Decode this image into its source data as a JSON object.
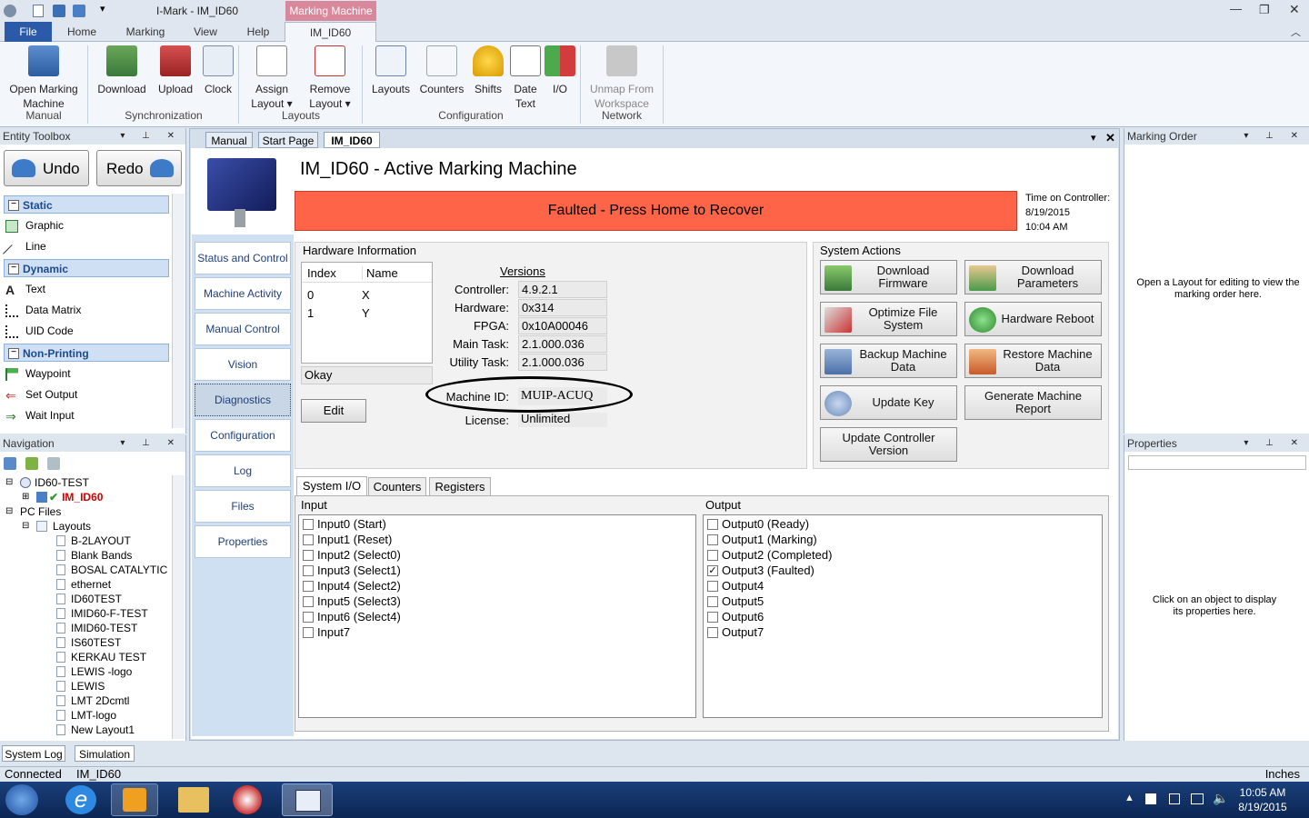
{
  "window": {
    "app_title": "I-Mark - IM_ID60",
    "context_tab": "Marking Machine"
  },
  "ribbon_tabs": [
    "File",
    "Home",
    "Marking",
    "View",
    "Help",
    "IM_ID60"
  ],
  "ribbon": {
    "open": "Open Marking\nMachine",
    "download": "Download",
    "upload": "Upload",
    "clock": "Clock",
    "assign": "Assign\nLayout ▾",
    "remove": "Remove\nLayout ▾",
    "layouts": "Layouts",
    "counters": "Counters",
    "shifts": "Shifts",
    "datetext": "Date\nText",
    "io": "I/O",
    "unmap": "Unmap From\nWorkspace",
    "groups": {
      "manual": "Manual",
      "sync": "Synchronization",
      "layouts": "Layouts",
      "config": "Configuration",
      "network": "Network"
    }
  },
  "toolbox": {
    "title": "Entity Toolbox",
    "undo": "Undo",
    "redo": "Redo",
    "cat_static": "Static",
    "graphic": "Graphic",
    "line": "Line",
    "cat_dynamic": "Dynamic",
    "text": "Text",
    "datamatrix": "Data Matrix",
    "uid": "UID Code",
    "cat_nonprint": "Non-Printing",
    "waypoint": "Waypoint",
    "setoutput": "Set Output",
    "waitinput": "Wait Input"
  },
  "navigation": {
    "title": "Navigation",
    "root": "ID60-TEST",
    "machine": "IM_ID60",
    "pcfiles": "PC Files",
    "layouts": "Layouts",
    "files": [
      "B-2LAYOUT",
      "Blank Bands",
      "BOSAL CATALYTIC",
      "ethernet",
      "ID60TEST",
      "IMID60-F-TEST",
      "IMID60-TEST",
      "IS60TEST",
      "KERKAU TEST",
      "LEWIS -logo",
      "LEWIS",
      "LMT 2Dcmtl",
      "LMT-logo",
      "New Layout1"
    ]
  },
  "doc_tabs": [
    "Manual",
    "Start Page",
    "IM_ID60"
  ],
  "machine": {
    "title": "IM_ID60 - Active Marking Machine",
    "status": "Faulted - Press Home to Recover",
    "time_label": "Time on Controller:",
    "time_date": "8/19/2015",
    "time_time": "10:04 AM"
  },
  "side_nav": [
    "Status and Control",
    "Machine Activity",
    "Manual Control",
    "Vision",
    "Diagnostics",
    "Configuration",
    "Log",
    "Files",
    "Properties"
  ],
  "hardware": {
    "title": "Hardware Information",
    "col_index": "Index",
    "col_name": "Name",
    "axes": [
      {
        "index": "0",
        "name": "X"
      },
      {
        "index": "1",
        "name": "Y"
      }
    ],
    "okay": "Okay",
    "edit": "Edit",
    "versions_title": "Versions",
    "versions": [
      {
        "label": "Controller:",
        "value": "4.9.2.1"
      },
      {
        "label": "Hardware:",
        "value": "0x314"
      },
      {
        "label": "FPGA:",
        "value": "0x10A00046"
      },
      {
        "label": "Main Task:",
        "value": "2.1.000.036"
      },
      {
        "label": "Utility Task:",
        "value": "2.1.000.036"
      }
    ],
    "machine_id_label": "Machine ID:",
    "machine_id": "MUIP-ACUQ",
    "license_label": "License:",
    "license": "Unlimited"
  },
  "system_actions": {
    "title": "System Actions",
    "download_firmware": "Download\nFirmware",
    "download_params": "Download\nParameters",
    "optimize": "Optimize File\nSystem",
    "reboot": "Hardware Reboot",
    "backup": "Backup Machine\nData",
    "restore": "Restore Machine\nData",
    "update_key": "Update Key",
    "report": "Generate Machine\nReport",
    "update_ctrl": "Update Controller\nVersion"
  },
  "io_tabs": [
    "System I/O",
    "Counters",
    "Registers"
  ],
  "io": {
    "input_title": "Input",
    "output_title": "Output",
    "inputs": [
      "Input0 (Start)",
      "Input1 (Reset)",
      "Input2 (Select0)",
      "Input3 (Select1)",
      "Input4 (Select2)",
      "Input5 (Select3)",
      "Input6 (Select4)",
      "Input7"
    ],
    "outputs": [
      "Output0 (Ready)",
      "Output1 (Marking)",
      "Output2 (Completed)",
      "Output3 (Faulted)",
      "Output4",
      "Output5",
      "Output6",
      "Output7"
    ],
    "checked_output": 3
  },
  "marking_order": {
    "title": "Marking Order",
    "hint": "Open a Layout for editing to view the marking order here."
  },
  "properties": {
    "title": "Properties",
    "hint": "Click on an object to display its properties here."
  },
  "bottom_tabs": [
    "System Log",
    "Simulation"
  ],
  "statusbar": {
    "connected": "Connected",
    "machine": "IM_ID60",
    "units": "Inches"
  },
  "taskbar": {
    "time": "10:05 AM",
    "date": "8/19/2015"
  },
  "colors": {
    "fault": "#fe6448",
    "accent": "#2b5aa8",
    "machine_red": "#d00000"
  }
}
